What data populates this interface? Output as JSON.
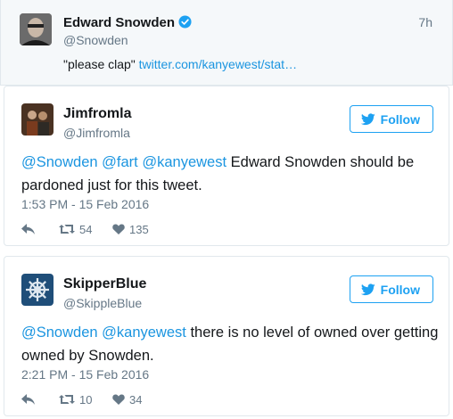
{
  "quoted_tweet": {
    "name": "Edward Snowden",
    "handle": "@Snowden",
    "time": "7h",
    "text": "\"please clap\"",
    "link": "twitter.com/kanyewest/stat…"
  },
  "replies": [
    {
      "name": "Jimfromla",
      "handle": "@Jimfromla",
      "follow_label": "Follow",
      "mentions": [
        "@Snowden",
        "@fart",
        "@kanyewest"
      ],
      "text_line1": "Edward Snowden should be",
      "text_line2": "pardoned just for this tweet.",
      "date": "1:53 PM - 15 Feb 2016",
      "retweets": "54",
      "likes": "135"
    },
    {
      "name": "SkipperBlue",
      "handle": "@SkippleBlue",
      "follow_label": "Follow",
      "mentions": [
        "@Snowden",
        "@kanyewest"
      ],
      "text_line1": "there is no level of owned over getting",
      "text_line2": "owned by Snowden.",
      "date": "2:21 PM - 15 Feb 2016",
      "retweets": "10",
      "likes": "34"
    }
  ],
  "colors": {
    "link": "#1b95e0",
    "follow": "#1da1f2",
    "muted": "#657786",
    "verified": "#1da1f2",
    "skipper_avatar": "#1f4e79"
  },
  "icons": [
    "verified-icon",
    "twitter-bird-icon",
    "reply-icon",
    "retweet-icon",
    "heart-icon"
  ]
}
